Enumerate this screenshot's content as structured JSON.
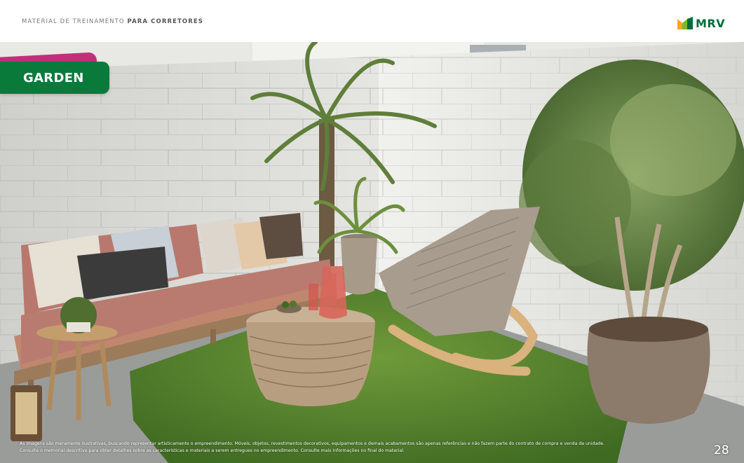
{
  "header": {
    "title_regular": "MATERIAL DE TREINAMENTO",
    "title_bold": "PARA CORRETORES"
  },
  "brand": {
    "name": "MRV",
    "colors": {
      "green": "#006e3b",
      "lime": "#7ab929",
      "orange": "#f5a623",
      "badge_green": "#0a7a3b",
      "magenta": "#c0307a"
    }
  },
  "section": {
    "label": "GARDEN"
  },
  "footer": {
    "disclaimer_line1": "As imagens são meramente ilustrativas, buscando representar artisticamente o empreendimento. Móveis, objetos, revestimentos decorativos, equipamentos e demais acabamentos são apenas referências e não fazem parte do contrato de compra e venda da unidade.",
    "disclaimer_line2": "Consulte o memorial descritivo para obter detalhes sobre as características e materiais a serem entregues no empreendimento. Consulte mais informações no final do material.",
    "page_number": "28"
  }
}
